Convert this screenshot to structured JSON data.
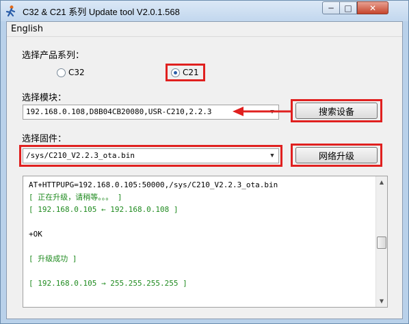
{
  "window": {
    "title": "C32 & C21 系列 Update tool V2.0.1.568",
    "min_glyph": "─",
    "max_glyph": "□",
    "close_glyph": "✕"
  },
  "menu": {
    "items": [
      {
        "label": "English"
      }
    ]
  },
  "product": {
    "label": "选择产品系列：",
    "options": [
      {
        "label": "C32",
        "selected": false
      },
      {
        "label": "C21",
        "selected": true
      }
    ]
  },
  "module": {
    "label": "选择模块：",
    "value": "192.168.0.108,D8B04CB20080,USR-C210,2.2.3",
    "search_button": "搜索设备"
  },
  "firmware": {
    "label": "选择固件：",
    "value": "/sys/C210_V2.2.3_ota.bin",
    "upgrade_button": "网络升级"
  },
  "log": {
    "lines": [
      {
        "text": "AT+HTTPUPG=192.168.0.105:50000,/sys/C210_V2.2.3_ota.bin",
        "color": "black"
      },
      {
        "text": "[ 正在升级，请稍等。。。 ]",
        "color": "green"
      },
      {
        "text": "[ 192.168.0.105 ← 192.168.0.108 ]",
        "color": "green"
      },
      {
        "text": "",
        "color": "black"
      },
      {
        "text": "+OK",
        "color": "black"
      },
      {
        "text": "",
        "color": "black"
      },
      {
        "text": "[ 升级成功 ]",
        "color": "green"
      },
      {
        "text": "",
        "color": "black"
      },
      {
        "text": "[ 192.168.0.105 → 255.255.255.255 ]",
        "color": "green"
      }
    ]
  },
  "colors": {
    "highlight": "#e0201f",
    "log_green": "#1e8a1e"
  },
  "icons": {
    "app": "person-icon",
    "dropdown": "chevron-down-icon"
  }
}
